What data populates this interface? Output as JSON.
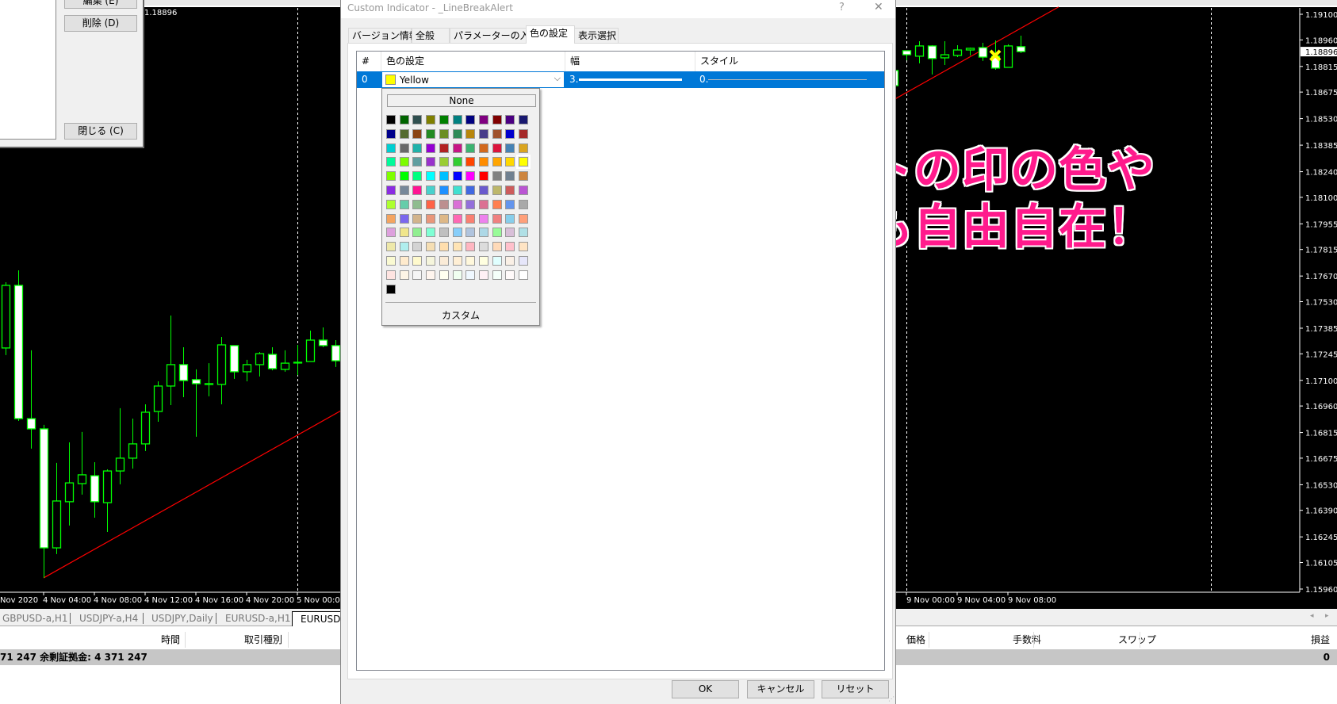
{
  "left_panel": {
    "edit_label": "編集 (E)",
    "delete_label": "削除 (D)",
    "close_label": "閉じる (C)"
  },
  "chart": {
    "price_label_top": "1.18896",
    "current_price": "1.18896",
    "price_axis": [
      "1.19100",
      "1.18960",
      "1.18815",
      "1.18675",
      "1.18530",
      "1.18385",
      "1.18240",
      "1.18100",
      "1.17955",
      "1.17815",
      "1.17670",
      "1.17530",
      "1.17385",
      "1.17245",
      "1.17100",
      "1.16960",
      "1.16815",
      "1.16675",
      "1.16530",
      "1.16390",
      "1.16245",
      "1.16105",
      "1.15960"
    ],
    "time_labels_left": [
      "Nov 2020",
      "4 Nov 04:00",
      "4 Nov 08:00",
      "4 Nov 12:00",
      "4 Nov 16:00",
      "4 Nov 20:00",
      "5 Nov 00:00"
    ],
    "time_labels_right": [
      "9 Nov 00:00",
      "9 Nov 04:00",
      "9 Nov 08:00"
    ],
    "colors": {
      "background": "#000000",
      "candle_outline": "#00ff00",
      "bear_fill": "#ffffff",
      "bull_fill": "#000000",
      "trendline": "#ff0000",
      "grid_separator": "#ffffff",
      "axis_text": "#ffffff"
    }
  },
  "chart_data": {
    "type": "candlestick",
    "timeframe": "H1",
    "ylim": [
      1.1596,
      1.191
    ],
    "candles": [
      {
        "t": "4 Nov 01:00",
        "o": 1.17277,
        "h": 1.17636,
        "l": 1.17238,
        "c": 1.17619
      },
      {
        "t": "4 Nov 02:00",
        "o": 1.17619,
        "h": 1.17701,
        "l": 1.16878,
        "c": 1.16891
      },
      {
        "t": "4 Nov 03:00",
        "o": 1.16891,
        "h": 1.17264,
        "l": 1.16727,
        "c": 1.16835
      },
      {
        "t": "4 Nov 04:00",
        "o": 1.16835,
        "h": 1.16857,
        "l": 1.16021,
        "c": 1.16185
      },
      {
        "t": "4 Nov 05:00",
        "o": 1.16185,
        "h": 1.16649,
        "l": 1.16151,
        "c": 1.16441
      },
      {
        "t": "4 Nov 06:00",
        "o": 1.16437,
        "h": 1.16761,
        "l": 1.16307,
        "c": 1.1654
      },
      {
        "t": "4 Nov 07:00",
        "o": 1.16536,
        "h": 1.16818,
        "l": 1.16476,
        "c": 1.16584
      },
      {
        "t": "4 Nov 08:00",
        "o": 1.16579,
        "h": 1.16653,
        "l": 1.1635,
        "c": 1.16437
      },
      {
        "t": "4 Nov 09:00",
        "o": 1.16432,
        "h": 1.16614,
        "l": 1.16272,
        "c": 1.16605
      },
      {
        "t": "4 Nov 10:00",
        "o": 1.16605,
        "h": 1.16948,
        "l": 1.16532,
        "c": 1.16675
      },
      {
        "t": "4 Nov 11:00",
        "o": 1.16675,
        "h": 1.16891,
        "l": 1.16618,
        "c": 1.16753
      },
      {
        "t": "4 Nov 12:00",
        "o": 1.16753,
        "h": 1.16969,
        "l": 1.16714,
        "c": 1.16926
      },
      {
        "t": "4 Nov 13:00",
        "o": 1.1693,
        "h": 1.17095,
        "l": 1.16874,
        "c": 1.17069
      },
      {
        "t": "4 Nov 14:00",
        "o": 1.17069,
        "h": 1.17454,
        "l": 1.16965,
        "c": 1.17186
      },
      {
        "t": "4 Nov 15:00",
        "o": 1.17186,
        "h": 1.17281,
        "l": 1.17008,
        "c": 1.17099
      },
      {
        "t": "4 Nov 16:00",
        "o": 1.17104,
        "h": 1.1716,
        "l": 1.16792,
        "c": 1.17082
      },
      {
        "t": "4 Nov 17:00",
        "o": 1.17078,
        "h": 1.17194,
        "l": 1.17013,
        "c": 1.17082
      },
      {
        "t": "4 Nov 18:00",
        "o": 1.17078,
        "h": 1.17337,
        "l": 1.16969,
        "c": 1.17294
      },
      {
        "t": "4 Nov 19:00",
        "o": 1.1729,
        "h": 1.1729,
        "l": 1.17108,
        "c": 1.17147
      },
      {
        "t": "4 Nov 20:00",
        "o": 1.17147,
        "h": 1.17212,
        "l": 1.17095,
        "c": 1.17186
      },
      {
        "t": "4 Nov 21:00",
        "o": 1.17186,
        "h": 1.17255,
        "l": 1.17121,
        "c": 1.17246
      },
      {
        "t": "4 Nov 22:00",
        "o": 1.17242,
        "h": 1.17281,
        "l": 1.17155,
        "c": 1.17164
      },
      {
        "t": "4 Nov 23:00",
        "o": 1.1716,
        "h": 1.17264,
        "l": 1.17147,
        "c": 1.17194
      },
      {
        "t": "5 Nov 00:00",
        "o": 1.17199,
        "h": 1.17294,
        "l": 1.17129,
        "c": 1.17199
      },
      {
        "t": "5 Nov 01:00",
        "o": 1.17203,
        "h": 1.17372,
        "l": 1.17203,
        "c": 1.1732
      },
      {
        "t": "5 Nov 02:00",
        "o": 1.1732,
        "h": 1.17389,
        "l": 1.17281,
        "c": 1.1729
      },
      {
        "t": "5 Nov 03:00",
        "o": 1.1729,
        "h": 1.1732,
        "l": 1.17173,
        "c": 1.17207
      },
      {
        "t": "6 Nov 23:00",
        "o": 1.18793,
        "h": 1.18793,
        "l": 1.1871,
        "c": 1.1871
      },
      {
        "t": "9 Nov 00:00",
        "o": 1.18901,
        "h": 1.18901,
        "l": 1.18849,
        "c": 1.18879
      },
      {
        "t": "9 Nov 01:00",
        "o": 1.18871,
        "h": 1.18953,
        "l": 1.18832,
        "c": 1.18927
      },
      {
        "t": "9 Nov 02:00",
        "o": 1.18927,
        "h": 1.18931,
        "l": 1.18771,
        "c": 1.18858
      },
      {
        "t": "9 Nov 03:00",
        "o": 1.18862,
        "h": 1.18953,
        "l": 1.18823,
        "c": 1.18879
      },
      {
        "t": "9 Nov 04:00",
        "o": 1.18875,
        "h": 1.18931,
        "l": 1.18866,
        "c": 1.18905
      },
      {
        "t": "9 Nov 05:00",
        "o": 1.18905,
        "h": 1.18918,
        "l": 1.18875,
        "c": 1.18914
      },
      {
        "t": "9 Nov 06:00",
        "o": 1.18918,
        "h": 1.18944,
        "l": 1.18845,
        "c": 1.18866
      },
      {
        "t": "9 Nov 07:00",
        "o": 1.18871,
        "h": 1.18957,
        "l": 1.18797,
        "c": 1.18806
      },
      {
        "t": "9 Nov 08:00",
        "o": 1.1881,
        "h": 1.18936,
        "l": 1.1881,
        "c": 1.18927
      },
      {
        "t": "9 Nov 09:00",
        "o": 1.18923,
        "h": 1.18983,
        "l": 1.18888,
        "c": 1.18896
      }
    ],
    "trendline": {
      "from": {
        "t": "4 Nov 04:00",
        "price": 1.16021
      },
      "to": {
        "t": "9 Nov 12:00",
        "price": 1.1914
      }
    },
    "day_separators": [
      "5 Nov 00:00",
      "9 Nov 00:00",
      "10 Nov 00:00"
    ],
    "alert_marker": {
      "t": "9 Nov 06:00",
      "price": 1.18875,
      "color": "#ffff00"
    }
  },
  "chart_tabs": [
    {
      "label": "GBPUSD-a,H1",
      "active": false
    },
    {
      "label": "USDJPY-a,H4",
      "active": false
    },
    {
      "label": "USDJPY,Daily",
      "active": false
    },
    {
      "label": "EURUSD-a,H1",
      "active": false
    },
    {
      "label": "EURUSD-",
      "active": true
    }
  ],
  "terminal": {
    "columns_left": [
      "時間",
      "取引種別"
    ],
    "columns_right": [
      "価格",
      "手数料",
      "スワップ",
      "損益"
    ],
    "balance_text": "71 247  余剰証拠金: 4 371 247",
    "profit_total": "0"
  },
  "dialog": {
    "title": "Custom Indicator - _LineBreakAlert",
    "help_label": "?",
    "close_label": "✕",
    "tabs": [
      "バージョン情報",
      "全般",
      "パラメーターの入力",
      "色の設定",
      "表示選択"
    ],
    "selected_tab": "色の設定",
    "table": {
      "headers": [
        "#",
        "色の設定",
        "幅",
        "スタイル"
      ],
      "row": {
        "index": "0",
        "color_name": "Yellow",
        "color_hex": "#ffff00",
        "width": "3.",
        "style": "0."
      }
    },
    "color_popup": {
      "none_label": "None",
      "custom_label": "カスタム",
      "selected": "Yellow",
      "palette": [
        [
          "black",
          "darkgreen",
          "darkslategray",
          "olive",
          "green",
          "teal",
          "navy",
          "purple",
          "maroon",
          "indigo",
          "midnightblue"
        ],
        [
          "darkblue",
          "darkolivegreen",
          "saddlebrown",
          "forestgreen",
          "olivedrab",
          "seagreen",
          "darkgoldenrod",
          "darkslateblue",
          "sienna",
          "mediumblue",
          "brown"
        ],
        [
          "darkturquoise",
          "dimgray",
          "lightseagreen",
          "darkviolet",
          "firebrick",
          "mediumvioletred",
          "mediumseagreen",
          "chocolate",
          "crimson",
          "steelblue",
          "goldenrod"
        ],
        [
          "mediumspringgreen",
          "lawngreen",
          "cadetblue",
          "darkorchid",
          "yellowgreen",
          "limegreen",
          "orangered",
          "darkorange",
          "orange",
          "gold",
          "yellow"
        ],
        [
          "chartreuse",
          "lime",
          "springgreen",
          "aqua",
          "deepskyblue",
          "blue",
          "magenta",
          "red",
          "gray",
          "slategray",
          "peru"
        ],
        [
          "blueviolet",
          "lightslategray",
          "deeppink",
          "mediumturquoise",
          "dodgerblue",
          "turquoise",
          "royalblue",
          "slateblue",
          "darkkhaki",
          "indianred",
          "mediumorchid"
        ],
        [
          "greenyellow",
          "mediumaquamarine",
          "darkseagreen",
          "tomato",
          "rosybrown",
          "orchid",
          "mediumpurple",
          "palevioletred",
          "coral",
          "cornflowerblue",
          "darkgray"
        ],
        [
          "sandybrown",
          "mediumslateblue",
          "tan",
          "darksalmon",
          "burlywood",
          "hotpink",
          "salmon",
          "violet",
          "lightcoral",
          "skyblue",
          "lightsalmon"
        ],
        [
          "plum",
          "khaki",
          "lightgreen",
          "aquamarine",
          "silver",
          "lightskyblue",
          "lightsteelblue",
          "lightblue",
          "palegreen",
          "thistle",
          "powderblue"
        ],
        [
          "palegoldenrod",
          "paleturquoise",
          "lightgray",
          "wheat",
          "navajowhite",
          "moccasin",
          "lightpink",
          "gainsboro",
          "peachpuff",
          "pink",
          "bisque"
        ],
        [
          "lightgoldenrodyellow",
          "blanchedalmond",
          "lemonchiffon",
          "beige",
          "antiquewhite",
          "papayawhip",
          "cornsilk",
          "lightyellow",
          "lightcyan",
          "linen",
          "lavender"
        ],
        [
          "mistyrose",
          "oldlace",
          "whitesmoke",
          "seashell",
          "ivory",
          "honeydew",
          "aliceblue",
          "lavenderblush",
          "mintcream",
          "snow",
          "white"
        ],
        [
          "black"
        ]
      ]
    },
    "buttons": {
      "ok": "OK",
      "cancel": "キャンセル",
      "reset": "リセット"
    }
  },
  "overlay_caption": {
    "line1": "アラートの印の色や",
    "line2": "大きさも自由自在！",
    "color": "#ff1a8c"
  }
}
